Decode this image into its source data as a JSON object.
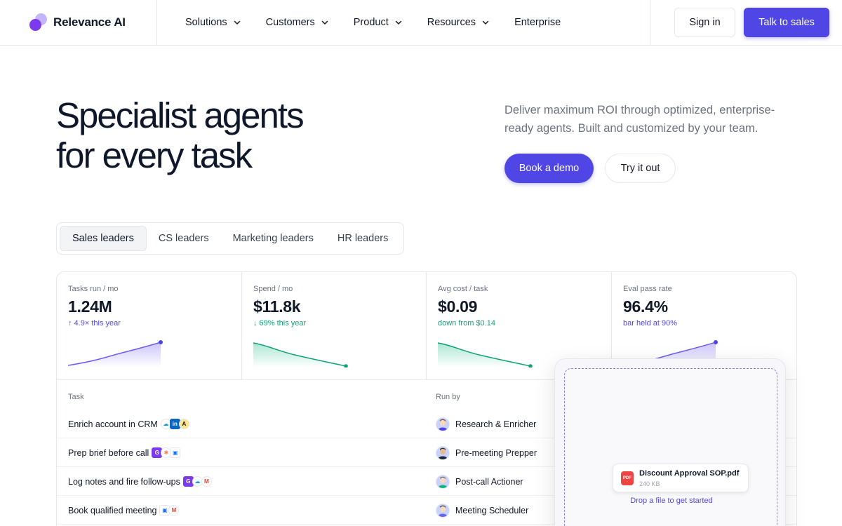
{
  "brand": {
    "name": "Relevance AI"
  },
  "nav": {
    "items": [
      {
        "label": "Solutions",
        "has_menu": true
      },
      {
        "label": "Customers",
        "has_menu": true
      },
      {
        "label": "Product",
        "has_menu": true
      },
      {
        "label": "Resources",
        "has_menu": true
      },
      {
        "label": "Enterprise",
        "has_menu": false
      }
    ],
    "sign_in": "Sign in",
    "talk_to_sales": "Talk to sales"
  },
  "hero": {
    "title_line1": "Specialist agents",
    "title_line2": "for every task",
    "subtitle": "Deliver maximum ROI through optimized, enterprise-ready agents. Built and customized by your team.",
    "primary_cta": "Book a demo",
    "secondary_cta": "Try it out"
  },
  "tabs": {
    "items": [
      "Sales leaders",
      "CS leaders",
      "Marketing leaders",
      "HR leaders"
    ],
    "active": "Sales leaders"
  },
  "stats": [
    {
      "label": "Tasks run / mo",
      "value": "1.24M",
      "delta": "↑ 4.9× this year",
      "tone": "purple",
      "trend": "up"
    },
    {
      "label": "Spend / mo",
      "value": "$11.8k",
      "delta": "↓ 69% this year",
      "tone": "green",
      "trend": "down"
    },
    {
      "label": "Avg cost / task",
      "value": "$0.09",
      "delta": "down from $0.14",
      "tone": "green",
      "trend": "down"
    },
    {
      "label": "Eval pass rate",
      "value": "96.4%",
      "delta": "bar held at 90%",
      "tone": "purple",
      "trend": "up"
    }
  ],
  "table": {
    "headers": {
      "task": "Task",
      "run_by": "Run by"
    },
    "rows": [
      {
        "task": "Enrich account in CRM",
        "icons": [
          "salesforce-icon",
          "linkedin-icon",
          "apollo-icon"
        ],
        "run_by": "Research & Enricher"
      },
      {
        "task": "Prep brief before call",
        "icons": [
          "gong-icon",
          "hubspot-icon",
          "google-calendar-icon"
        ],
        "run_by": "Pre-meeting Prepper"
      },
      {
        "task": "Log notes and fire follow-ups",
        "icons": [
          "gong-icon",
          "salesforce-icon",
          "gmail-icon"
        ],
        "run_by": "Post-call Actioner"
      },
      {
        "task": "Book qualified meeting",
        "icons": [
          "google-calendar-icon",
          "gmail-icon"
        ],
        "run_by": "Meeting Scheduler"
      }
    ]
  },
  "dropzone": {
    "file_name": "Discount Approval SOP.pdf",
    "file_size": "240 KB",
    "file_type": "PDF",
    "hint": "Drop a file to get started"
  },
  "colors": {
    "accent": "#4f46e5",
    "positive": "#0f9f7a",
    "border": "#e5e7eb",
    "muted_text": "#6b7280"
  }
}
